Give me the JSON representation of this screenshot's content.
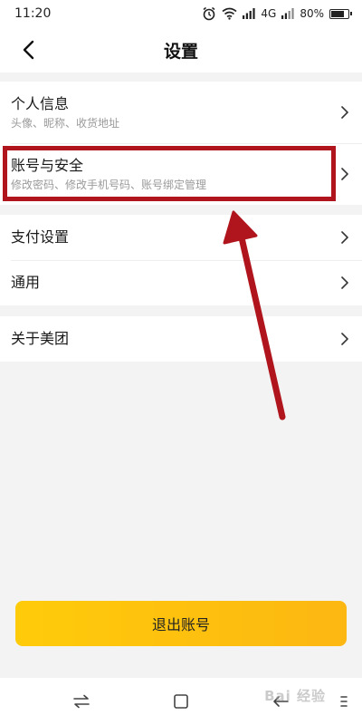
{
  "status_bar": {
    "time": "11:20",
    "network": "4G",
    "battery": "80%",
    "battery_fraction": 0.8
  },
  "header": {
    "title": "设置",
    "back_icon": "chevron-left-icon"
  },
  "settings": {
    "items": [
      {
        "title": "个人信息",
        "subtitle": "头像、昵称、收货地址"
      },
      {
        "title": "账号与安全",
        "subtitle": "修改密码、修改手机号码、账号绑定管理"
      },
      {
        "title": "支付设置"
      },
      {
        "title": "通用"
      },
      {
        "title": "关于美团"
      }
    ]
  },
  "logout": {
    "label": "退出账号"
  },
  "annotation": {
    "color": "#b0141c"
  },
  "watermark": {
    "text": "Bai 经验"
  },
  "colors": {
    "accent": "#fecb0a",
    "accent_end": "#fdb712",
    "background": "#f3f3f3"
  }
}
